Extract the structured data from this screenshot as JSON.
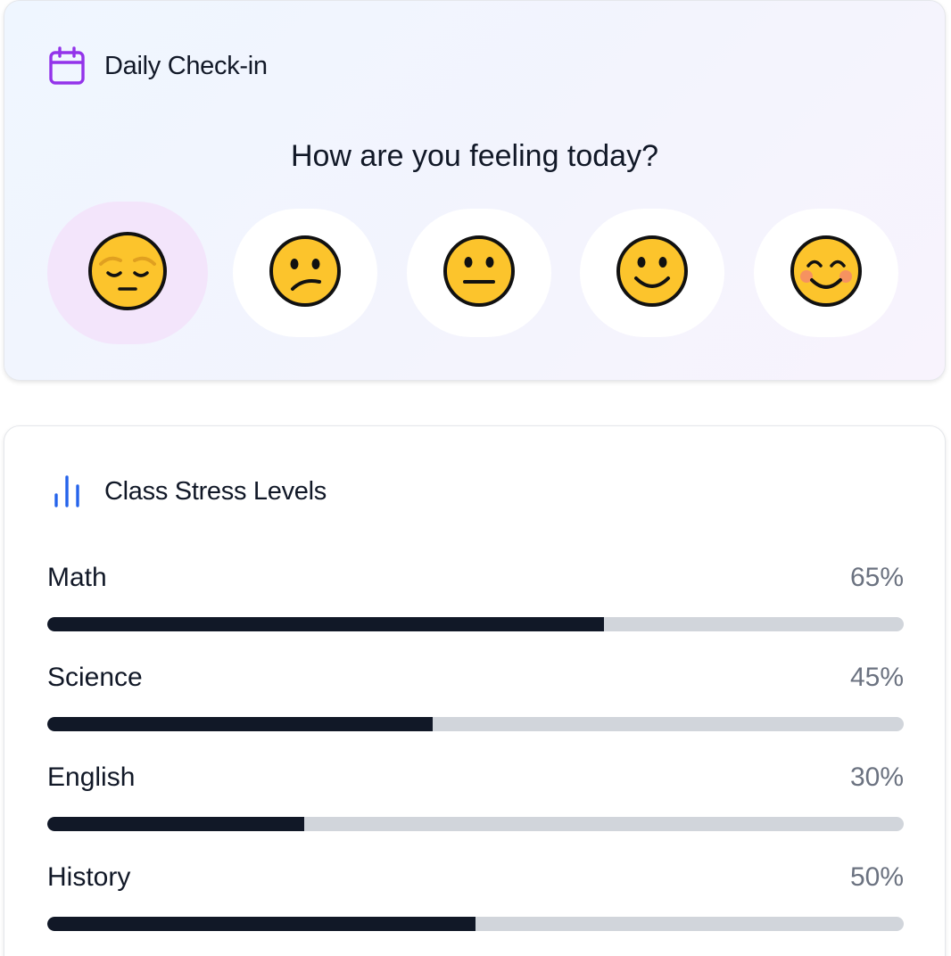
{
  "checkin": {
    "title": "Daily Check-in",
    "icon": "calendar-icon",
    "question": "How are you feeling today?",
    "selected_index": 0,
    "moods": [
      {
        "name": "pensive-face-icon"
      },
      {
        "name": "confused-face-icon"
      },
      {
        "name": "neutral-face-icon"
      },
      {
        "name": "slightly-smiling-face-icon"
      },
      {
        "name": "smiling-blush-face-icon"
      }
    ]
  },
  "stress": {
    "title": "Class Stress Levels",
    "icon": "bar-chart-icon",
    "subjects": [
      {
        "name": "Math",
        "percent_label": "65%",
        "value": 65
      },
      {
        "name": "Science",
        "percent_label": "45%",
        "value": 45
      },
      {
        "name": "English",
        "percent_label": "30%",
        "value": 30
      },
      {
        "name": "History",
        "percent_label": "50%",
        "value": 50
      }
    ]
  },
  "colors": {
    "calendar_icon": "#9333ea",
    "chart_icon": "#2563eb",
    "selected_mood_bg": "#f3e5fb",
    "bar_fill": "#111827",
    "bar_track": "#d1d5db",
    "emoji_face": "#fcc42c"
  }
}
